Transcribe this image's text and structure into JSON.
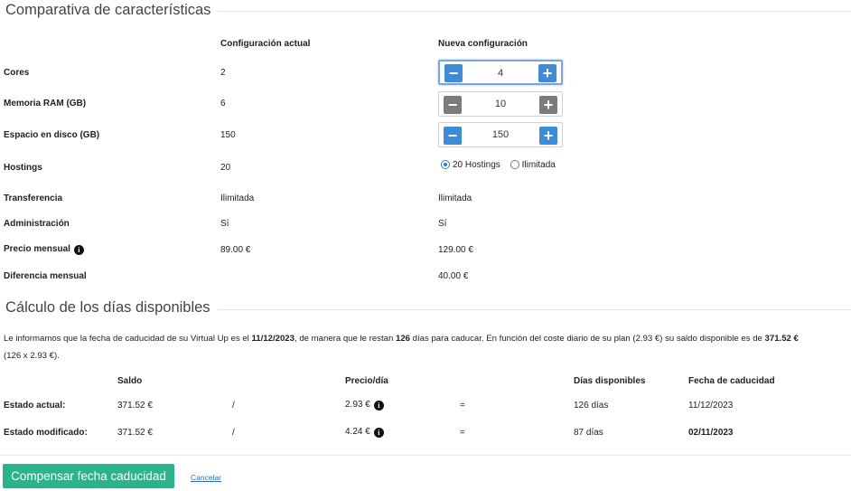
{
  "features": {
    "legend": "Comparativa de características",
    "col_current": "Configuración actual",
    "col_new": "Nueva configuración",
    "rows": [
      {
        "label": "Cores",
        "current": "2"
      },
      {
        "label": "Memoria RAM (GB)",
        "current": "6"
      },
      {
        "label": "Espacio en disco (GB)",
        "current": "150"
      },
      {
        "label": "Hostings",
        "current": "20"
      },
      {
        "label": "Transferencia",
        "current": "Ilimitada",
        "new": "Ilimitada"
      },
      {
        "label": "Administración",
        "current": "Sí",
        "new": "Sí"
      },
      {
        "label": "Precio mensual",
        "current": "89.00 €",
        "new": "129.00 €"
      },
      {
        "label": "Diferencia mensual",
        "new": "40.00 €"
      }
    ],
    "steppers": {
      "cores": "4",
      "ram": "10",
      "disk": "150"
    },
    "hostings_options": [
      "20 Hostings",
      "Ilimitada"
    ],
    "hostings_selected": "20 Hostings"
  },
  "days": {
    "legend": "Cálculo de los días disponibles",
    "info": {
      "p1": "Le informamos que la fecha de caducidad de su Virtual Up es el ",
      "date": "11/12/2023",
      "p2": ", de manera que le restan ",
      "days": "126",
      "p3": " días para caducar. En función del coste diario de su plan (2.93 €) su saldo disponible es de ",
      "balance": "371.52 €",
      "line2": "(126 x 2.93 €)."
    },
    "headers": {
      "saldo": "Saldo",
      "precio": "Precio/día",
      "dias": "Días disponibles",
      "fecha": "Fecha de caducidad"
    },
    "rows": [
      {
        "label": "Estado actual:",
        "saldo": "371.52 €",
        "div": "/",
        "precio": "2.93 €",
        "eq": "=",
        "dias": "126 días",
        "fecha": "11/12/2023"
      },
      {
        "label": "Estado modificado:",
        "saldo": "371.52 €",
        "div": "/",
        "precio": "4.24 €",
        "eq": "=",
        "dias": "87 días",
        "fecha": "02/11/2023"
      }
    ]
  },
  "actions": {
    "submit": "Compensar fecha caducidad",
    "cancel": "Cancelar"
  },
  "colors": {
    "accent_blue": "#3d8bd9",
    "success_green": "#2ab48c",
    "disabled_gray": "#7b7b7b"
  }
}
